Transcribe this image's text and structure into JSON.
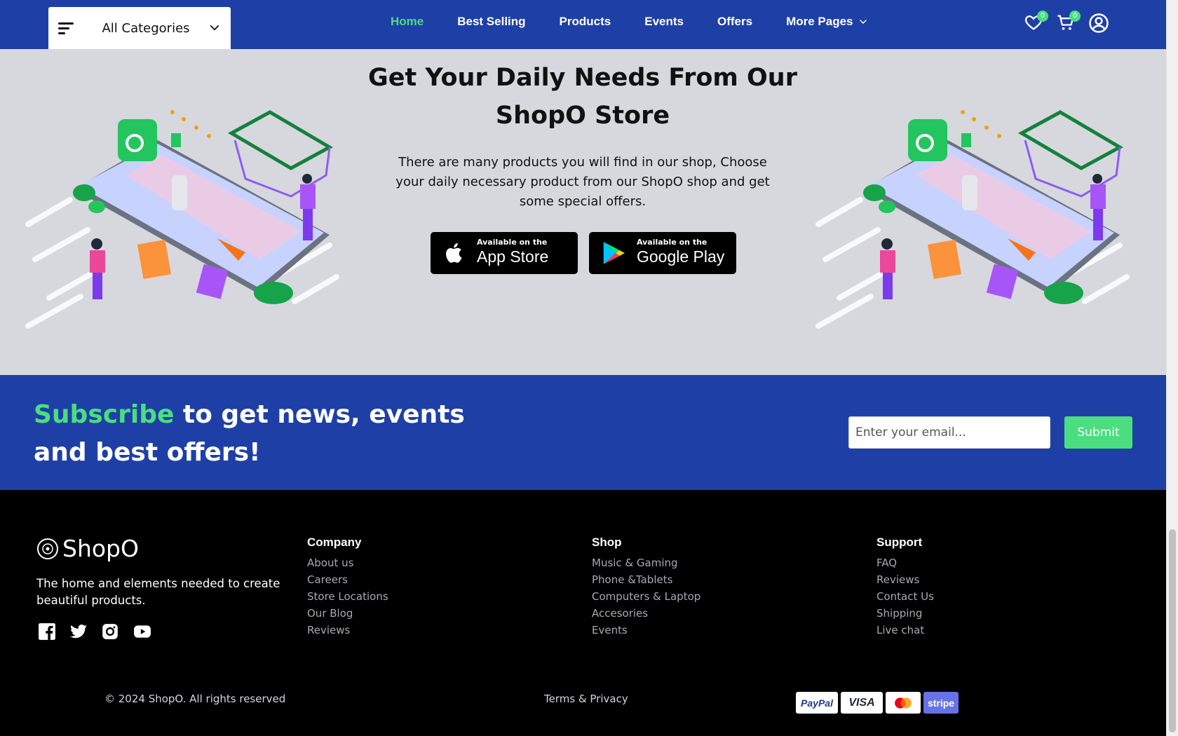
{
  "header": {
    "category_select": "All Categories",
    "nav": [
      {
        "label": "Home"
      },
      {
        "label": "Best Selling"
      },
      {
        "label": "Products"
      },
      {
        "label": "Events"
      },
      {
        "label": "Offers"
      },
      {
        "label": "More Pages"
      }
    ],
    "wishlist_count": "0",
    "cart_count": "0"
  },
  "hero": {
    "title": "Get Your Daily Needs From Our ShopO Store",
    "description": "There are many products you will find in our shop, Choose your daily necessary product from our ShopO shop and get some special offers.",
    "app_store": {
      "small": "Available on the",
      "big": "App Store"
    },
    "google_play": {
      "small": "Available on the",
      "big": "Google Play"
    }
  },
  "subscribe": {
    "accent": "Subscribe",
    "rest": "to get news, events and best offers!",
    "email_placeholder": "Enter your email...",
    "submit_label": "Submit"
  },
  "footer": {
    "logo": "ShopO",
    "description": "The home and elements needed to create beautiful products.",
    "social": [
      "facebook-icon",
      "twitter-icon",
      "instagram-icon",
      "youtube-icon"
    ],
    "columns": [
      {
        "title": "Company",
        "links": [
          "About us",
          "Careers",
          "Store Locations",
          "Our Blog",
          "Reviews"
        ]
      },
      {
        "title": "Shop",
        "links": [
          "Music & Gaming",
          "Phone &Tablets",
          "Computers & Laptop",
          "Accesories",
          "Events"
        ]
      },
      {
        "title": "Support",
        "links": [
          "FAQ",
          "Reviews",
          "Contact Us",
          "Shipping",
          "Live chat"
        ]
      }
    ],
    "copyright": "© 2024 ShopO. All rights reserved",
    "terms": "Terms & Privacy",
    "payments": [
      "PayPal",
      "VISA",
      "",
      "stripe"
    ]
  },
  "colors": {
    "brand_blue": "#1e40a6",
    "accent_green": "#4ade80",
    "hero_bg": "#d6d8de",
    "footer_bg": "#000000"
  }
}
